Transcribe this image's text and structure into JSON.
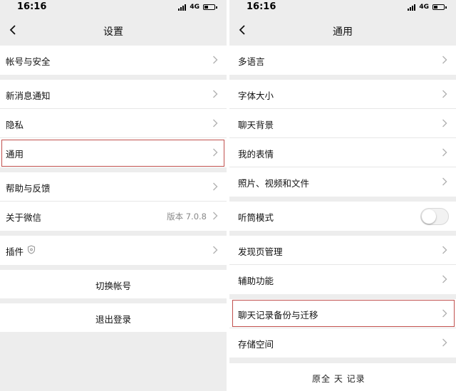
{
  "left": {
    "status": {
      "time": "16:16",
      "network": "4G"
    },
    "nav": {
      "title": "设置"
    },
    "groups": [
      [
        "帐号与安全"
      ],
      [
        "新消息通知",
        "隐私",
        "通用"
      ],
      [
        "帮助与反馈",
        "关于微信"
      ],
      [
        "插件"
      ]
    ],
    "about_value": "版本 7.0.8",
    "switch_account": "切换帐号",
    "logout": "退出登录"
  },
  "right": {
    "status": {
      "time": "16:16",
      "network": "4G"
    },
    "nav": {
      "title": "通用"
    },
    "groups": [
      [
        "多语言"
      ],
      [
        "字体大小",
        "聊天背景",
        "我的表情",
        "照片、视频和文件"
      ],
      [
        "听筒模式"
      ],
      [
        "发现页管理",
        "辅助功能"
      ],
      [
        "聊天记录备份与迁移",
        "存储空间"
      ]
    ],
    "earpiece_mode_on": false
  },
  "watermark": "原全 天 记录",
  "colors": {
    "highlight": "#c0504d",
    "background": "#ededed",
    "chevron": "#b2b2b2"
  }
}
